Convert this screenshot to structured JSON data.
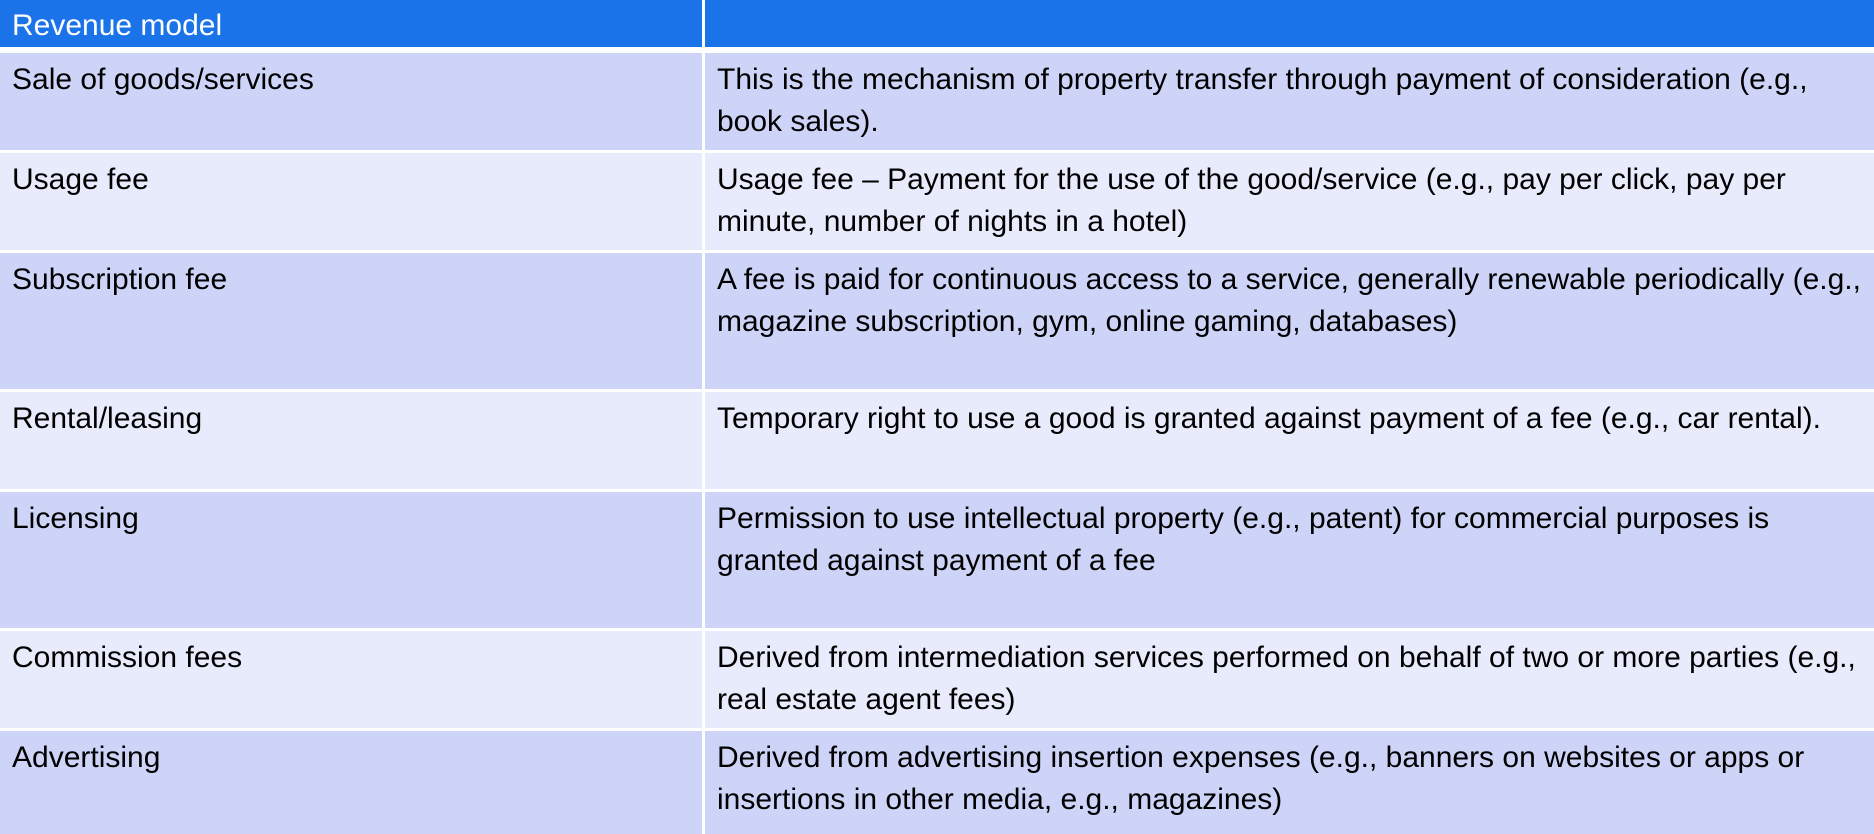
{
  "table": {
    "header": {
      "col1": "Revenue model",
      "col2": ""
    },
    "rows": [
      {
        "model": "Sale of goods/services",
        "description": "This is the mechanism of property transfer through payment of consideration (e.g., book sales)."
      },
      {
        "model": "Usage fee",
        "description": "Usage fee  – Payment for the use of the good/service (e.g., pay per click, pay per minute, number of nights in a hotel)"
      },
      {
        "model": "Subscription fee",
        "description": "A fee is paid for continuous access to a service, generally renewable periodically (e.g., magazine subscription, gym, online gaming, databases)"
      },
      {
        "model": "Rental/leasing",
        "description": "Temporary right to use a good is granted against payment of a fee (e.g., car rental)."
      },
      {
        "model": "Licensing",
        "description": "Permission to use intellectual property (e.g., patent) for commercial purposes is granted against payment of a fee"
      },
      {
        "model": "Commission fees",
        "description": "Derived from intermediation services performed on behalf of two or more parties (e.g., real estate agent fees)"
      },
      {
        "model": "Advertising",
        "description": "Derived from advertising insertion expenses (e.g., banners on websites or apps or insertions in other media, e.g., magazines)"
      }
    ]
  },
  "colors": {
    "header_bg": "#1a73e8",
    "row_dark": "#cdd4f7",
    "row_light": "#e8ebfc"
  }
}
